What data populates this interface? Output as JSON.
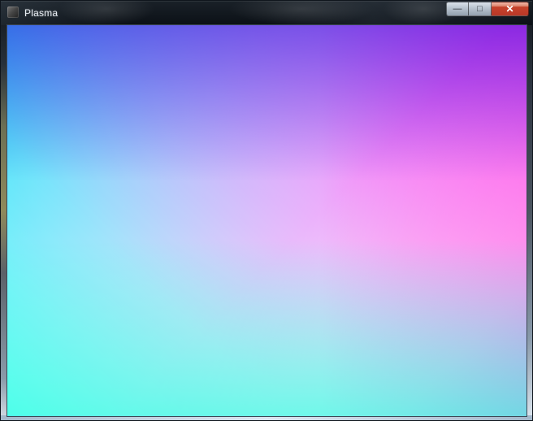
{
  "window": {
    "title": "Plasma",
    "icon": "app-icon"
  },
  "controls": {
    "minimize_icon": "minimize-icon",
    "maximize_icon": "maximize-icon",
    "close_icon": "close-icon",
    "minimize_label": "—",
    "maximize_label": "□",
    "close_label": "✕"
  },
  "canvas": {
    "name": "plasma-canvas",
    "gradient": {
      "top_left": "#0a0fd0",
      "top_right": "#ff08e0",
      "bottom_left": "#06ffd7",
      "bottom_right": "#fefacb"
    }
  }
}
